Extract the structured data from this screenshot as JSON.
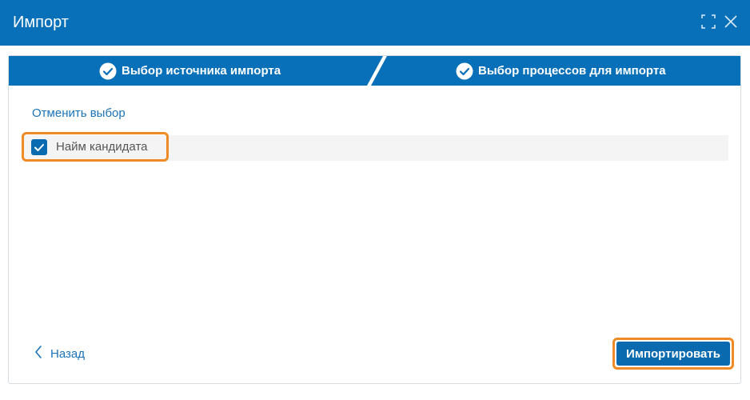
{
  "window": {
    "title": "Импорт"
  },
  "steps": [
    {
      "label": "Выбор источника импорта",
      "icon": "check-circle-icon"
    },
    {
      "label": "Выбор процессов для импорта",
      "icon": "check-circle-icon"
    }
  ],
  "content": {
    "cancel_selection_label": "Отменить выбор",
    "items": [
      {
        "label": "Найм кандидата",
        "checked": true
      }
    ]
  },
  "footer": {
    "back_label": "Назад",
    "import_label": "Импортировать"
  },
  "colors": {
    "primary": "#0870b8",
    "link": "#1a73b8",
    "highlight": "#f08a24"
  }
}
